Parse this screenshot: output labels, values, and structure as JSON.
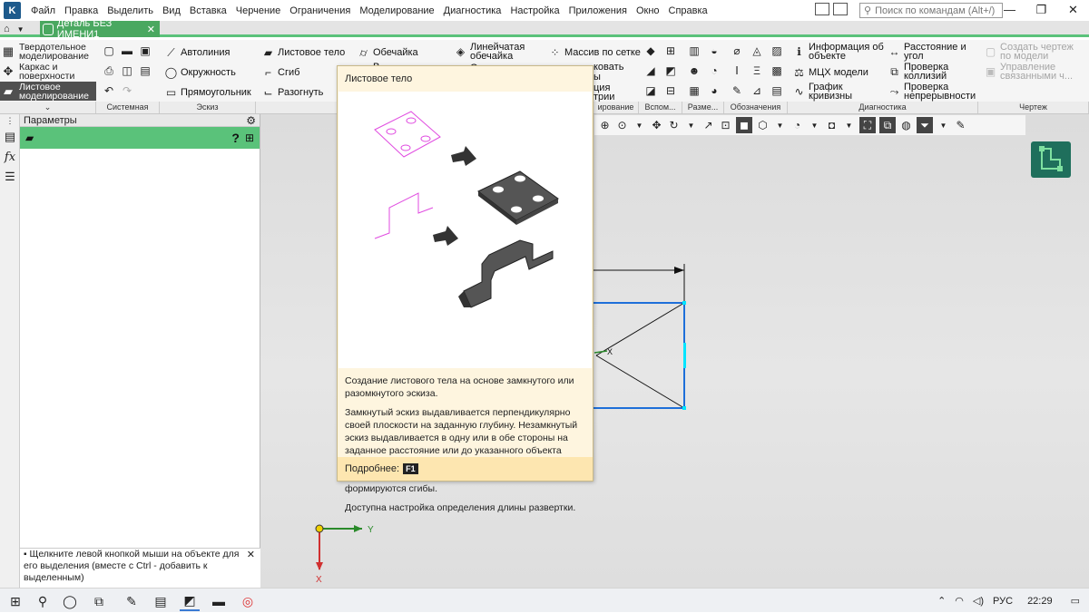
{
  "menu": {
    "items": [
      "Файл",
      "Правка",
      "Выделить",
      "Вид",
      "Вставка",
      "Черчение",
      "Ограничения",
      "Моделирование",
      "Диагностика",
      "Настройка",
      "Приложения",
      "Окно",
      "Справка"
    ],
    "search_placeholder": "Поиск по командам (Alt+/)"
  },
  "document_tab": {
    "title": "Деталь БЕЗ ИМЕНИ1"
  },
  "modes": [
    {
      "label1": "Твердотельное",
      "label2": "моделирование",
      "icon": "solid-icon"
    },
    {
      "label1": "Каркас и",
      "label2": "поверхности",
      "icon": "wireframe-icon"
    },
    {
      "label1": "Листовое",
      "label2": "моделирование",
      "icon": "sheet-icon"
    }
  ],
  "sketch": {
    "line": "Автолиния",
    "circle": "Окружность",
    "rect": "Прямоугольник"
  },
  "sheet": {
    "body": "Листовое тело",
    "bend": "Сгиб",
    "unbend": "Разогнуть",
    "shell": "Обечайка",
    "linear_shell1": "Линейчатая",
    "linear_shell2": "обечайка"
  },
  "array": {
    "label": "Массив по сетке"
  },
  "diagnostics": {
    "info1": "Информация об",
    "info2": "объекте",
    "mass": "МЦХ модели",
    "graph1": "График",
    "graph2": "кривизны",
    "dist1": "Расстояние и",
    "dist2": "угол",
    "collision1": "Проверка",
    "collision2": "коллизий",
    "continuity1": "Проверка",
    "continuity2": "непрерывности"
  },
  "drawing": {
    "create1": "Создать чертеж",
    "create2": "по модели",
    "manage1": "Управление",
    "manage2": "связанными ч..."
  },
  "partial_labels": {
    "a": "О",
    "b": "В",
    "c": "ковать",
    "d": "ы",
    "e": "ция",
    "f": "трии"
  },
  "groups": {
    "system": "Системная",
    "sketch": "Эскиз",
    "partial": "ирование",
    "aux": "Вспом...",
    "dims": "Разме...",
    "notes": "Обозначения",
    "diag": "Диагностика",
    "drawing": "Чертеж"
  },
  "params_panel": {
    "title": "Параметры"
  },
  "hint": {
    "text": "Щелкните левой кнопкой мыши на объекте для его выделения (вместе с Ctrl - добавить к выделенным)"
  },
  "tooltip": {
    "title": "Листовое тело",
    "p1": "Создание листового тела на основе замкнутого или разомкнутого эскиза.",
    "p2": "Замкнутый эскиз выдавливается перпендикулярно своей плоскости на заданную глубину. Незамкнутый эскиз выдавливается в одну или в обе стороны на заданное расстояние или до указанного объекта (вершина, поверхность); к полученной поверхности добавляется слой материала; в углах контура формируются сгибы.",
    "p3": "Доступна настройка определения длины развертки.",
    "more": "Подробнее:",
    "key": "F1"
  },
  "axes": {
    "x": "X",
    "y": "Y"
  },
  "taskbar": {
    "lang": "РУС",
    "time": "22:29"
  },
  "colors": {
    "accent_green": "#5ac27a",
    "tooltip_bg": "#fef5df",
    "selection_blue": "#1e6fd9"
  }
}
